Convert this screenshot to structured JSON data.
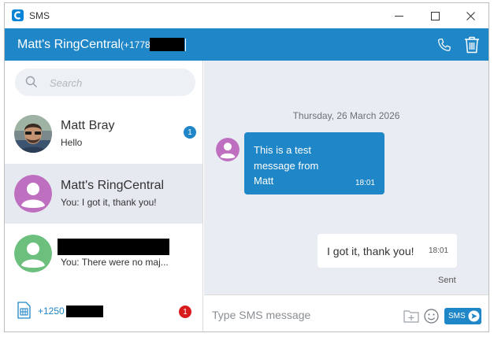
{
  "window": {
    "title": "SMS"
  },
  "header": {
    "title": "Matt's RingCentral",
    "number": "(+1778"
  },
  "search": {
    "placeholder": "Search",
    "value": ""
  },
  "conversations": [
    {
      "name": "Matt Bray",
      "preview": "Hello",
      "unread": "1"
    },
    {
      "name": "Matt's RingCentral",
      "preview": "You: I got it, thank you!"
    },
    {
      "name": "",
      "preview": "You: There were no maj..."
    }
  ],
  "footer": {
    "number": "+1250",
    "badge": "1"
  },
  "chat": {
    "date": "Thursday, 26 March 2026",
    "messages": [
      {
        "direction": "incoming",
        "text": "This is a test message from Matt",
        "time": "18:01"
      },
      {
        "direction": "outgoing",
        "text": "I got it, thank you!",
        "time": "18:01",
        "status": "Sent"
      }
    ]
  },
  "compose": {
    "placeholder": "Type SMS message",
    "value": "",
    "send_label": "SMS"
  },
  "colors": {
    "accent": "#1f86c7",
    "badge_red": "#d81b1b",
    "chat_bg": "#e9edf3",
    "avatar_purple": "#bf6fbf",
    "avatar_green": "#6cbf7c"
  },
  "icons": [
    "app-logo-icon",
    "minimize-icon",
    "maximize-icon",
    "close-icon",
    "phone-icon",
    "trash-icon",
    "search-icon",
    "sim-card-icon",
    "attach-icon",
    "emoji-icon",
    "send-icon"
  ]
}
